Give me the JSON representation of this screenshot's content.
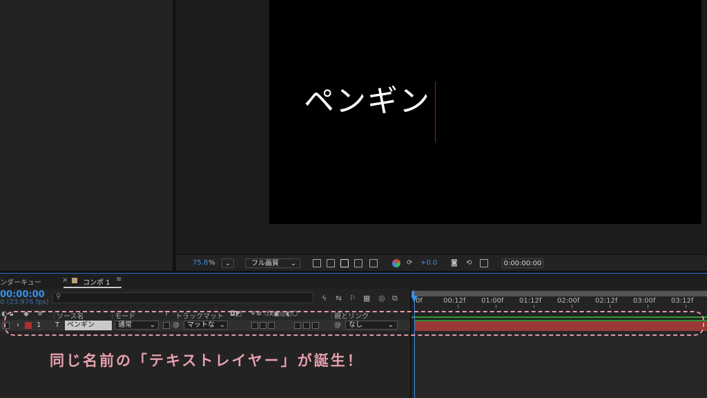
{
  "viewer": {
    "comp_text": "ペンギン",
    "toolbar": {
      "zoom_value": "75.8",
      "zoom_unit": "%",
      "resolution": "フル画質",
      "exposure": "+0.0",
      "timecode": "0:00:00:00"
    }
  },
  "timeline": {
    "tabs": {
      "render_queue": "ンダーキュー",
      "close": "×",
      "comp_label": "コンポ 1",
      "menu": "≡"
    },
    "timecode": "00:00:00",
    "fps": "0 (23.976 fps)",
    "columns": {
      "hash": "#",
      "source_name": "ソース名",
      "mode": "モード",
      "t": "T",
      "track_matte": "トラックマット",
      "parent_link": "親とリンク"
    },
    "layer": {
      "index": "1",
      "type_glyph": "T",
      "name": "ペンギン",
      "mode": "通常",
      "matte": "マットな",
      "parent": "なし"
    },
    "ruler_ticks": [
      "0f",
      "00:12f",
      "01:00f",
      "01:12f",
      "02:00f",
      "02:12f",
      "03:00f",
      "03:12f"
    ]
  },
  "annotation": {
    "caption": "同じ名前の「テキストレイヤー」が誕生！"
  },
  "colors": {
    "accent_blue": "#3a8eea",
    "layer_label_red": "#b03030",
    "annotation_pink": "#e8a0ad",
    "comp_swatch": "#b9a379"
  }
}
